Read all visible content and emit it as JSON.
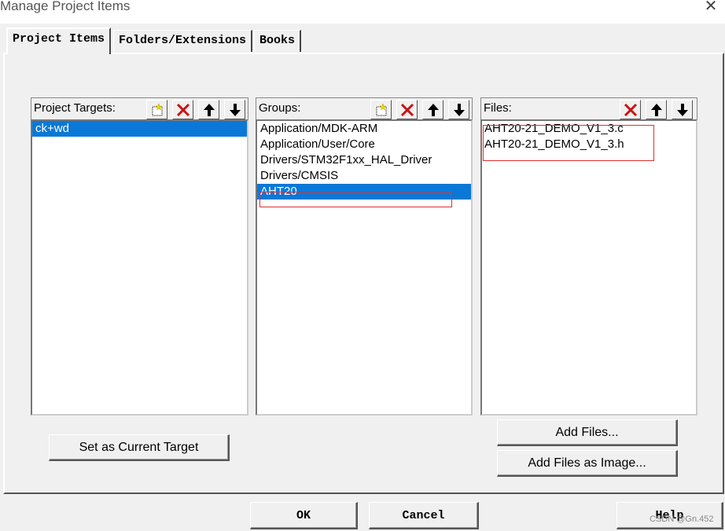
{
  "window": {
    "title": "Manage Project Items",
    "close_glyph": "✕"
  },
  "tabs": [
    {
      "label": "Project Items",
      "active": true
    },
    {
      "label": "Folders/Extensions",
      "active": false
    },
    {
      "label": "Books",
      "active": false
    }
  ],
  "targets": {
    "label": "Project Targets:",
    "items": [
      "ck+wd"
    ],
    "selected_index": 0
  },
  "groups": {
    "label": "Groups:",
    "items": [
      "Application/MDK-ARM",
      "Application/User/Core",
      "Drivers/STM32F1xx_HAL_Driver",
      "Drivers/CMSIS",
      "AHT20"
    ],
    "selected_index": 4
  },
  "files": {
    "label": "Files:",
    "items": [
      "AHT20-21_DEMO_V1_3.c",
      "AHT20-21_DEMO_V1_3.h"
    ]
  },
  "buttons": {
    "set_current_target": "Set as Current Target",
    "add_files": "Add Files...",
    "add_files_image": "Add Files as Image...",
    "ok": "OK",
    "cancel": "Cancel",
    "help": "Help"
  },
  "icons": {
    "new": "new-item-icon",
    "delete": "delete-x-icon",
    "up": "move-up-arrow-icon",
    "down": "move-down-arrow-icon"
  },
  "colors": {
    "selection": "#0a78d7",
    "annotation": "#e03030",
    "delete_icon": "#cc1111"
  },
  "watermark": "CSDN @Gn.452"
}
